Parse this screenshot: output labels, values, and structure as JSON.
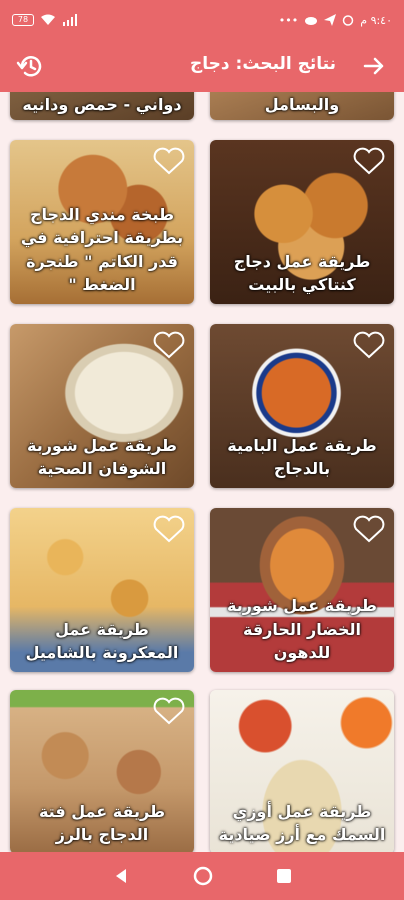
{
  "status_bar": {
    "battery": "78",
    "time": "٩:٤٠ م"
  },
  "header": {
    "title": "نتائج البحث: دجاج",
    "back_icon": "arrow-right-icon",
    "history_icon": "history-icon"
  },
  "results": [
    {
      "title": "دواني - حمص ودانيه",
      "favorite": false
    },
    {
      "title": "والبسامل",
      "favorite": false
    },
    {
      "title": "طبخة مندي الدجاج بطريقة احترافية في قدر الكاتم \" طنجرة الضغط \"",
      "favorite": false
    },
    {
      "title": "طريقة عمل دجاج كنتاكي بالبيت",
      "favorite": false
    },
    {
      "title": "طريقة عمل شوربة الشوفان الصحية",
      "favorite": false
    },
    {
      "title": "طريقة عمل البامية بالدجاج",
      "favorite": false
    },
    {
      "title": "طريقة عمل المعكرونة بالشاميل",
      "favorite": false
    },
    {
      "title": "طريقة عمل شوربة الخضار الحارقة للدهون",
      "favorite": false
    },
    {
      "title": "طريقة عمل فتة الدجاج بالرز",
      "favorite": false
    },
    {
      "title": "طريقة عمل أوزي السمك مع أرز صيادية",
      "favorite": false
    }
  ],
  "nav": {
    "back": "nav-back-icon",
    "home": "nav-home-icon",
    "recents": "nav-recents-icon"
  },
  "colors": {
    "accent": "#e8676a",
    "background": "#fbeeee"
  }
}
